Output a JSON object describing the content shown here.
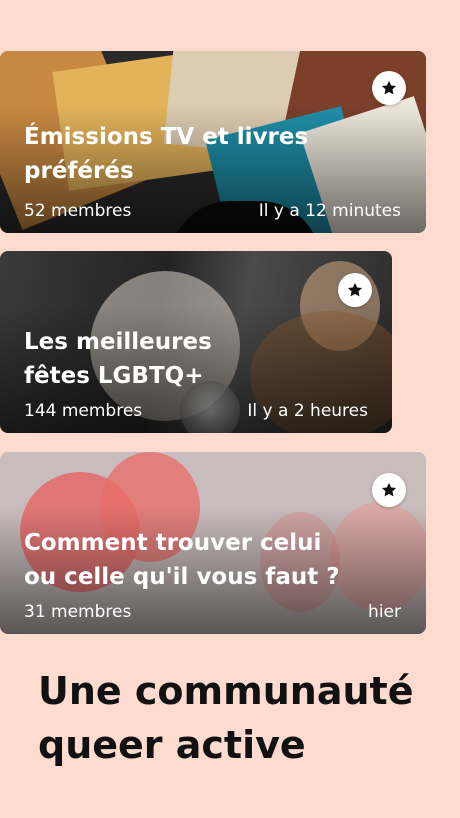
{
  "colors": {
    "background": "#FDDCCF",
    "card_text": "#FFFFFF",
    "headline_text": "#111111",
    "fav_button_bg": "#FFFFFF",
    "fav_icon": "#111111"
  },
  "groups": [
    {
      "title": "Émissions TV et livres\npréférés",
      "members": "52 membres",
      "time": "Il y a 12 minutes",
      "fav_icon": "star-icon"
    },
    {
      "title": "Les meilleures\nfêtes LGBTQ+",
      "members": "144 membres",
      "time": "Il y a 2 heures",
      "fav_icon": "star-icon"
    },
    {
      "title": "Comment trouver celui\nou celle qu'il vous faut ?",
      "members": "31 membres",
      "time": "hier",
      "fav_icon": "star-icon"
    }
  ],
  "headline": {
    "line1": "Une communauté",
    "line2": "queer active"
  }
}
